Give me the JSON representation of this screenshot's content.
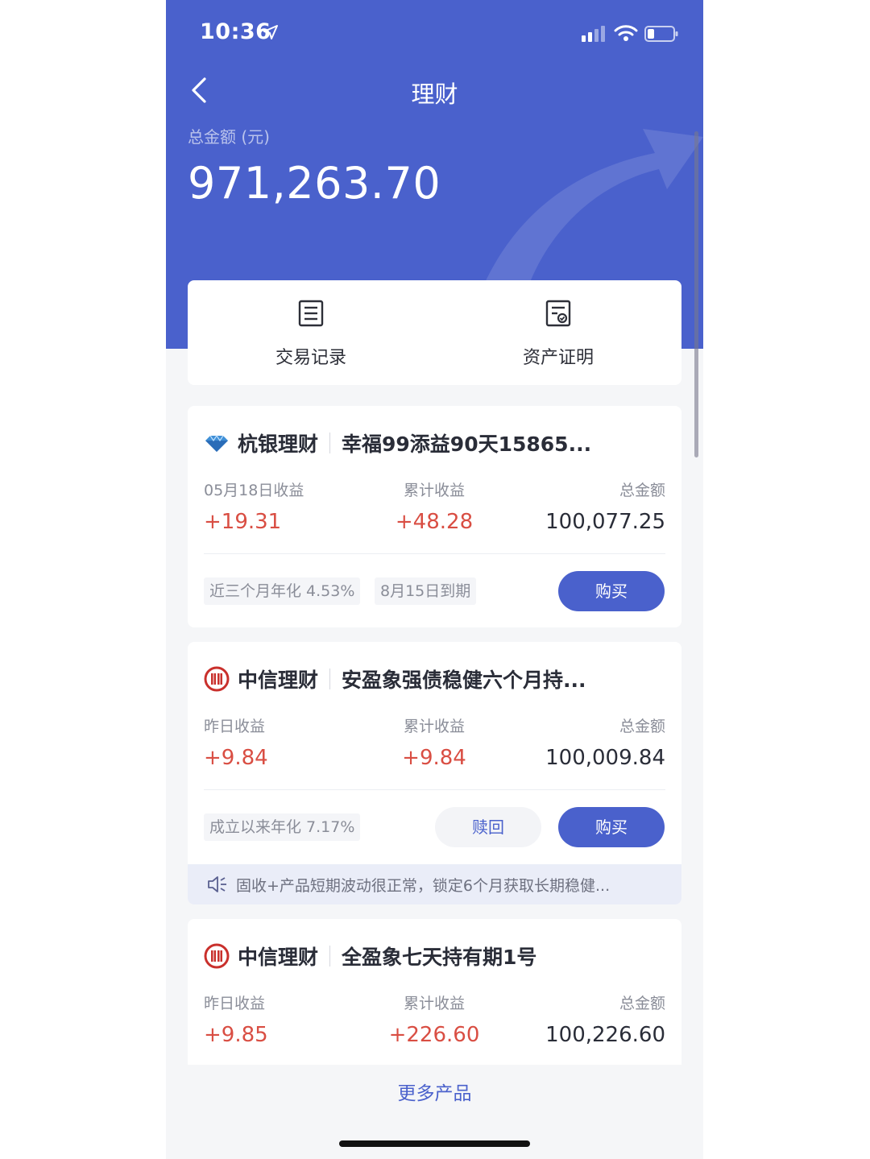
{
  "status_bar": {
    "time": "10:36"
  },
  "nav": {
    "title": "理财"
  },
  "summary": {
    "label": "总金额 (元)",
    "amount": "971,263.70"
  },
  "quick_actions": [
    {
      "label": "交易记录",
      "icon": "list-document-icon"
    },
    {
      "label": "资产证明",
      "icon": "certificate-icon"
    }
  ],
  "products": [
    {
      "brand": "杭银理财",
      "name": "幸福99添益90天15865...",
      "stats": [
        {
          "label": "05月18日收益",
          "value": "+19.31"
        },
        {
          "label": "累计收益",
          "value": "+48.28"
        },
        {
          "label": "总金额",
          "value": "100,077.25"
        }
      ],
      "tags": [
        "近三个月年化 4.53%",
        "8月15日到期"
      ],
      "buy_label": "购买"
    },
    {
      "brand": "中信理财",
      "name": "安盈象强债稳健六个月持...",
      "stats": [
        {
          "label": "昨日收益",
          "value": "+9.84"
        },
        {
          "label": "累计收益",
          "value": "+9.84"
        },
        {
          "label": "总金额",
          "value": "100,009.84"
        }
      ],
      "tags": [
        "成立以来年化 7.17%"
      ],
      "redeem_label": "赎回",
      "buy_label": "购买",
      "notice": "固收+产品短期波动很正常，锁定6个月获取长期稳健..."
    },
    {
      "brand": "中信理财",
      "name": "全盈象七天持有期1号",
      "stats": [
        {
          "label": "昨日收益",
          "value": "+9.85"
        },
        {
          "label": "累计收益",
          "value": "+226.60"
        },
        {
          "label": "总金额",
          "value": "100,226.60"
        }
      ]
    }
  ],
  "footer": {
    "more_label": "更多产品"
  },
  "colors": {
    "primary": "#4a61cc",
    "positive": "#d94e43",
    "background": "#f5f6f8"
  }
}
